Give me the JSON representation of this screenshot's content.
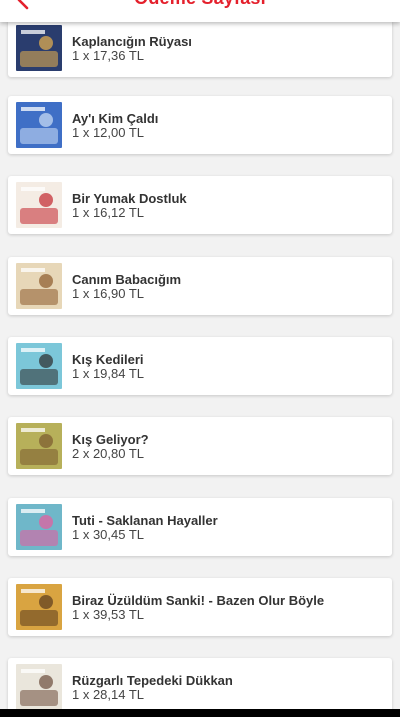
{
  "header": {
    "title": "Ödeme Sayfası"
  },
  "items": [
    {
      "name": "Kaplancığın Rüyası",
      "qty": "1 x 17,36 TL",
      "cover_colors": [
        "#2a3d6e",
        "#e9b24d"
      ]
    },
    {
      "name": "Ay'ı Kim Çaldı",
      "qty": "1 x 12,00 TL",
      "cover_colors": [
        "#3f6fc6",
        "#cfe0f7"
      ]
    },
    {
      "name": "Bir Yumak Dostluk",
      "qty": "1 x 16,12 TL",
      "cover_colors": [
        "#f4ece4",
        "#c2262e"
      ]
    },
    {
      "name": "Canım Babacığım",
      "qty": "1 x 16,90 TL",
      "cover_colors": [
        "#e7d7b8",
        "#8c5a2b"
      ]
    },
    {
      "name": "Kış Kedileri",
      "qty": "1 x 19,84 TL",
      "cover_colors": [
        "#7cc7d9",
        "#2b2b2b"
      ]
    },
    {
      "name": "Kış Geliyor?",
      "qty": "2 x 20,80 TL",
      "cover_colors": [
        "#b7b05a",
        "#7a5a2e"
      ]
    },
    {
      "name": "Tuti - Saklanan Hayaller",
      "qty": "1 x 30,45 TL",
      "cover_colors": [
        "#6fb7c9",
        "#e95a9c"
      ]
    },
    {
      "name": "Biraz Üzüldüm Sanki! - Bazen Olur Böyle",
      "qty": "1 x 39,53 TL",
      "cover_colors": [
        "#d9a441",
        "#5a3a1e"
      ]
    },
    {
      "name": "Rüzgarlı Tepedeki Dükkan",
      "qty": "1 x 28,14 TL",
      "cover_colors": [
        "#eae6dc",
        "#6b4b3a"
      ]
    }
  ]
}
